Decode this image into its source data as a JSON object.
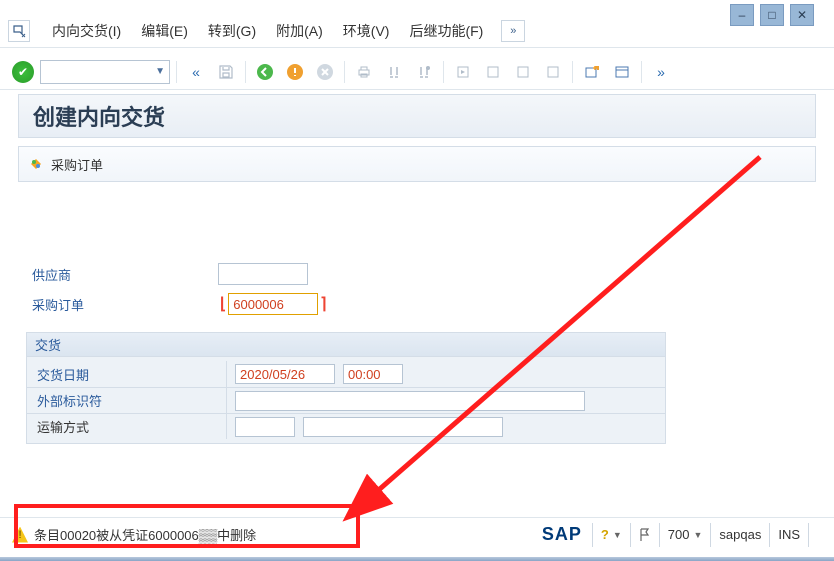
{
  "window_controls": {
    "min": "–",
    "max": "□",
    "close": "✕"
  },
  "menu": {
    "items": [
      {
        "label": "内向交货(I)"
      },
      {
        "label": "编辑(E)"
      },
      {
        "label": "转到(G)"
      },
      {
        "label": "附加(A)"
      },
      {
        "label": "环境(V)"
      },
      {
        "label": "后继功能(F)"
      }
    ],
    "expand": "»"
  },
  "toolbar": {
    "back": "«",
    "expand": "»"
  },
  "page_title": "创建内向交货",
  "sub_bar": {
    "label": "采购订单"
  },
  "form": {
    "supplier_label": "供应商",
    "supplier_value": "",
    "po_label": "采购订单",
    "po_value": "6000006"
  },
  "group": {
    "title": "交货",
    "delivery_date_label": "交货日期",
    "delivery_date_value": "2020/05/26",
    "delivery_time_value": "00:00",
    "ext_id_label": "外部标识符",
    "ext_id_value": "",
    "transport_label": "运输方式"
  },
  "status": {
    "message": "条目00020被从凭证6000006▒▒中删除",
    "logo": "SAP",
    "client": "700",
    "system": "sapqas",
    "mode": "INS"
  }
}
